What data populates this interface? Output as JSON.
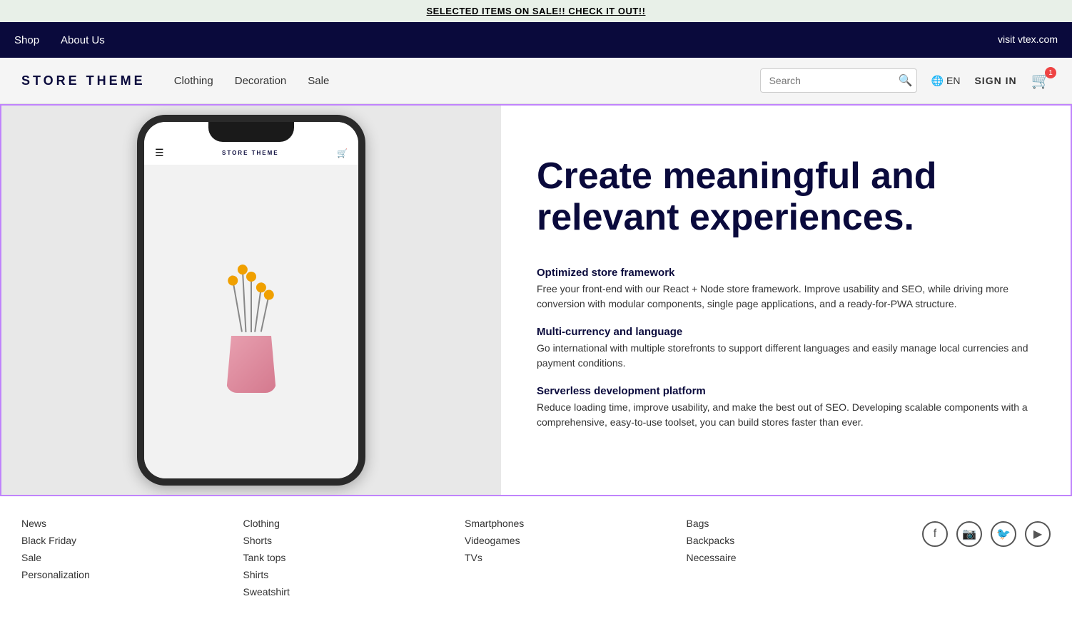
{
  "announcement": {
    "text": "SELECTED ITEMS ON SALE!! CHECK IT OUT!!"
  },
  "top_nav": {
    "left_links": [
      "Shop",
      "About Us"
    ],
    "right_link": "visit vtex.com"
  },
  "main_nav": {
    "logo": "STORE THEME",
    "links": [
      "Clothing",
      "Decoration",
      "Sale"
    ],
    "search_placeholder": "Search",
    "lang": "EN",
    "sign_in": "SIGN IN",
    "cart_count": "1"
  },
  "hero": {
    "title": "Create meaningful and relevant experiences.",
    "features": [
      {
        "title": "Optimized store framework",
        "desc": "Free your front-end with our React + Node store framework. Improve usability and SEO, while driving more conversion with modular components, single page applications, and a ready-for-PWA structure."
      },
      {
        "title": "Multi-currency and language",
        "desc": "Go international with multiple storefronts to support different languages and easily manage local currencies and payment conditions."
      },
      {
        "title": "Serverless development platform",
        "desc": "Reduce loading time, improve usability, and make the best out of SEO. Developing scalable components with a comprehensive, easy-to-use toolset, you can build stores faster than ever."
      }
    ]
  },
  "footer": {
    "col1": {
      "links": [
        "News",
        "Black Friday",
        "Sale",
        "Personalization"
      ]
    },
    "col2": {
      "links": [
        "Clothing",
        "Shorts",
        "Tank tops",
        "Shirts",
        "Sweatshirt"
      ]
    },
    "col3": {
      "links": [
        "Smartphones",
        "Videogames",
        "TVs"
      ]
    },
    "col4": {
      "links": [
        "Bags",
        "Backpacks",
        "Necessaire"
      ]
    },
    "social": [
      "facebook",
      "instagram",
      "twitter",
      "youtube"
    ]
  }
}
